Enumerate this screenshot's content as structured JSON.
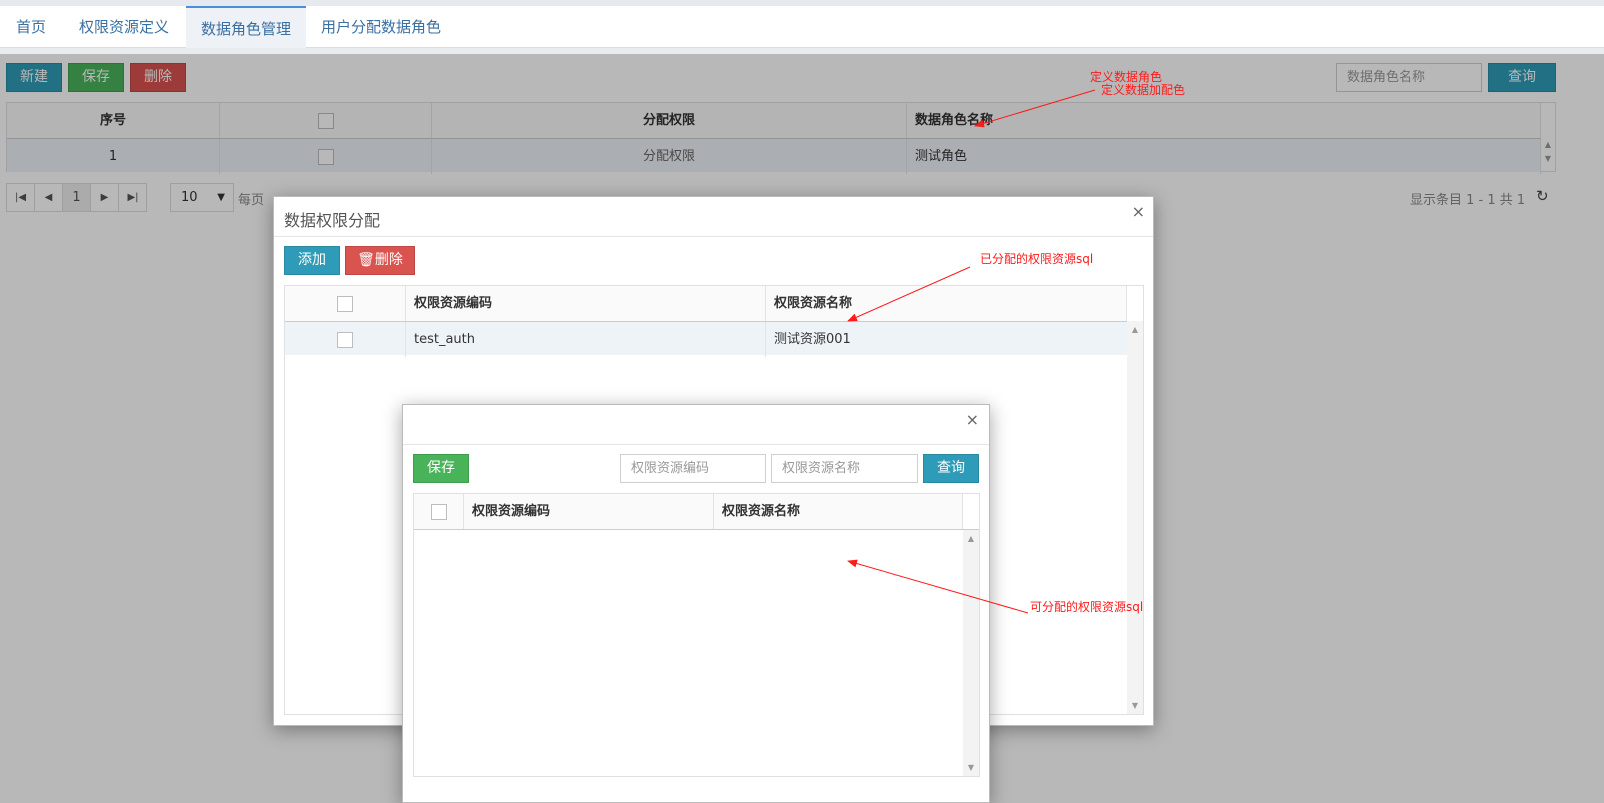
{
  "tabs": [
    "首页",
    "权限资源定义",
    "数据角色管理",
    "用户分配数据角色"
  ],
  "toolbar": {
    "new": "新建",
    "save": "保存",
    "delete": "删除",
    "search_placeholder": "数据角色名称",
    "query": "查询"
  },
  "main_table": {
    "headers": [
      "序号",
      "",
      "分配权限",
      "数据角色名称"
    ],
    "rows": [
      {
        "index": "1",
        "assign": "分配权限",
        "name": "测试角色"
      }
    ]
  },
  "pager": {
    "page": "1",
    "page_size": "10",
    "per_page": "每页",
    "summary": "显示条目 1 - 1 共 1"
  },
  "dialog1": {
    "title": "数据权限分配",
    "add": "添加",
    "delete": "删除",
    "headers": [
      "",
      "权限资源编码",
      "权限资源名称"
    ],
    "rows": [
      {
        "code": "test_auth",
        "name": "测试资源001"
      }
    ]
  },
  "dialog2": {
    "save": "保存",
    "code_placeholder": "权限资源编码",
    "name_placeholder": "权限资源名称",
    "query": "查询",
    "headers": [
      "",
      "权限资源编码",
      "权限资源名称"
    ]
  },
  "annotations": {
    "a1": "定义数据角色",
    "a2": "定义数据加配色",
    "a3": "已分配的权限资源sql",
    "a4": "可分配的权限资源sql"
  },
  "icons": {
    "close": "close-icon",
    "trash": "trash-icon",
    "refresh": "refresh-icon"
  },
  "colors": {
    "blue": "#2e9cb8",
    "green": "#49b35a",
    "red": "#d9534f",
    "annotation": "#ff1a1a"
  }
}
